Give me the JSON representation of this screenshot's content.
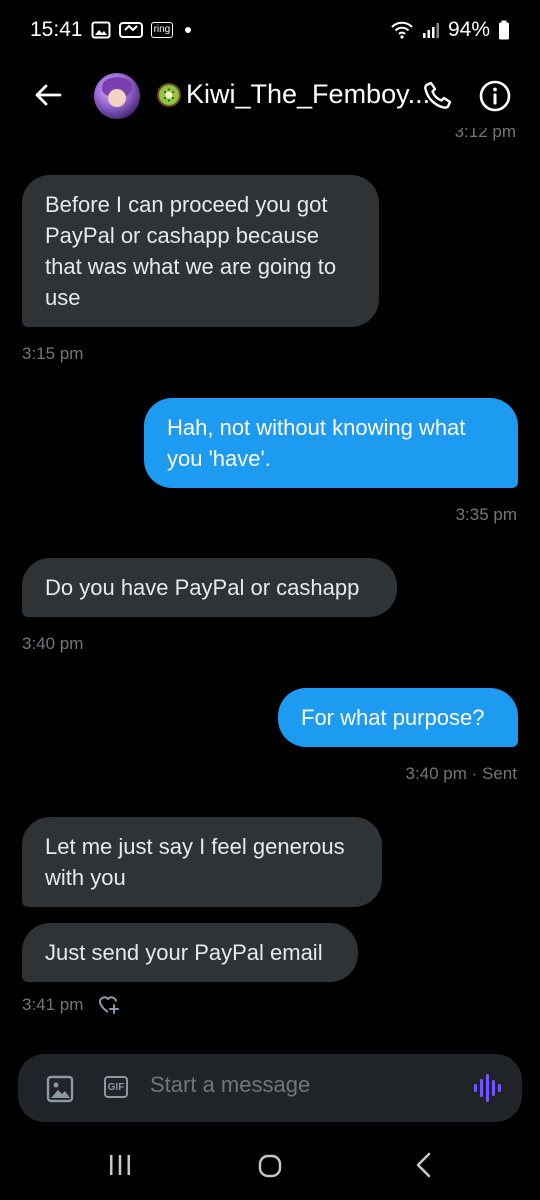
{
  "status_bar": {
    "time": "15:41",
    "battery": "94%",
    "badge": "ring"
  },
  "header": {
    "name": "Kiwi_The_Femboy...",
    "icons": [
      "back-arrow-icon",
      "kiwi-emoji-icon",
      "phone-icon",
      "info-icon"
    ]
  },
  "conversation": {
    "messages": [
      {
        "side": "received",
        "text": "Before I can proceed you got PayPal or cashapp because that was what we are going to use",
        "time": "3:15 pm"
      },
      {
        "side": "sent",
        "text": "Hah, not without knowing what you 'have'.",
        "time": "3:35 pm"
      },
      {
        "side": "received",
        "text": "Do you have PayPal or cashapp",
        "time": "3:40 pm"
      },
      {
        "side": "sent",
        "text": "For what purpose?",
        "time": "3:40 pm · Sent"
      },
      {
        "side": "received",
        "text": "Let me just say I feel generous with you"
      },
      {
        "side": "received",
        "text": "Just send your PayPal email",
        "time": "3:41 pm"
      }
    ]
  },
  "composer": {
    "placeholder": "Start a message",
    "gif_label": "GIF"
  },
  "colors": {
    "background": "#000000",
    "sent_bubble": "#1d9bf0",
    "received_bubble": "#2f3336",
    "accent_voice": "#7856ff"
  }
}
